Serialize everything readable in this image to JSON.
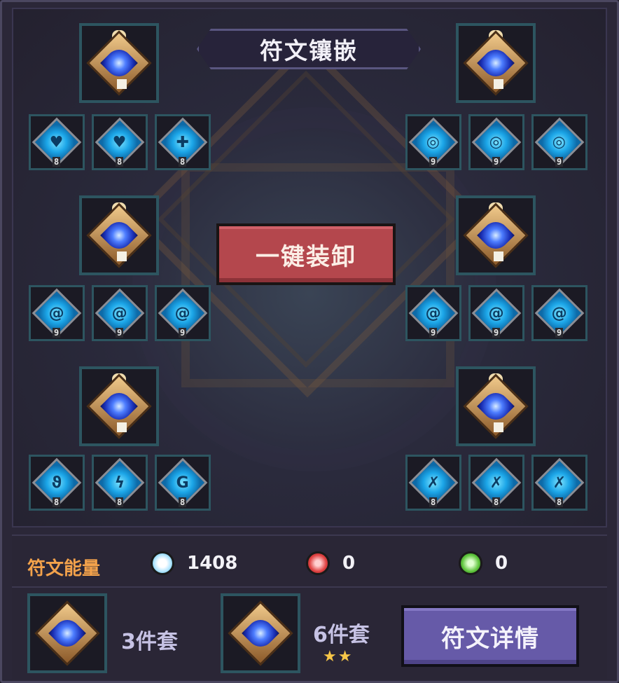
{
  "title": "符文镶嵌",
  "unequip_button": "一键装卸",
  "groups": [
    {
      "runes": [
        {
          "level": "8"
        },
        {
          "level": "8"
        },
        {
          "level": "8"
        }
      ]
    },
    {
      "runes": [
        {
          "level": "9"
        },
        {
          "level": "9"
        },
        {
          "level": "9"
        }
      ]
    },
    {
      "runes": [
        {
          "level": "9"
        },
        {
          "level": "9"
        },
        {
          "level": "9"
        }
      ]
    },
    {
      "runes": [
        {
          "level": "9"
        },
        {
          "level": "9"
        },
        {
          "level": "9"
        }
      ]
    },
    {
      "runes": [
        {
          "level": "8"
        },
        {
          "level": "8"
        },
        {
          "level": "8"
        }
      ]
    },
    {
      "runes": [
        {
          "level": "8"
        },
        {
          "level": "8"
        },
        {
          "level": "8"
        }
      ]
    }
  ],
  "energy": {
    "label": "符文能量",
    "resources": [
      {
        "icon": "white-crystal-icon",
        "value": "1408",
        "color": "#e8f6ff"
      },
      {
        "icon": "red-crystal-icon",
        "value": "0",
        "color": "#e04242"
      },
      {
        "icon": "green-crystal-icon",
        "value": "0",
        "color": "#5ec43c"
      }
    ]
  },
  "sets": [
    {
      "label": "3件套",
      "stars": ""
    },
    {
      "label": "6件套",
      "stars": "★★"
    }
  ],
  "detail_button": "符文详情",
  "colors": {
    "energy_label": "#f3a24b",
    "unequip_button": "#b4474d",
    "detail_button": "#665aa8",
    "slot_border": "#2d5560"
  }
}
